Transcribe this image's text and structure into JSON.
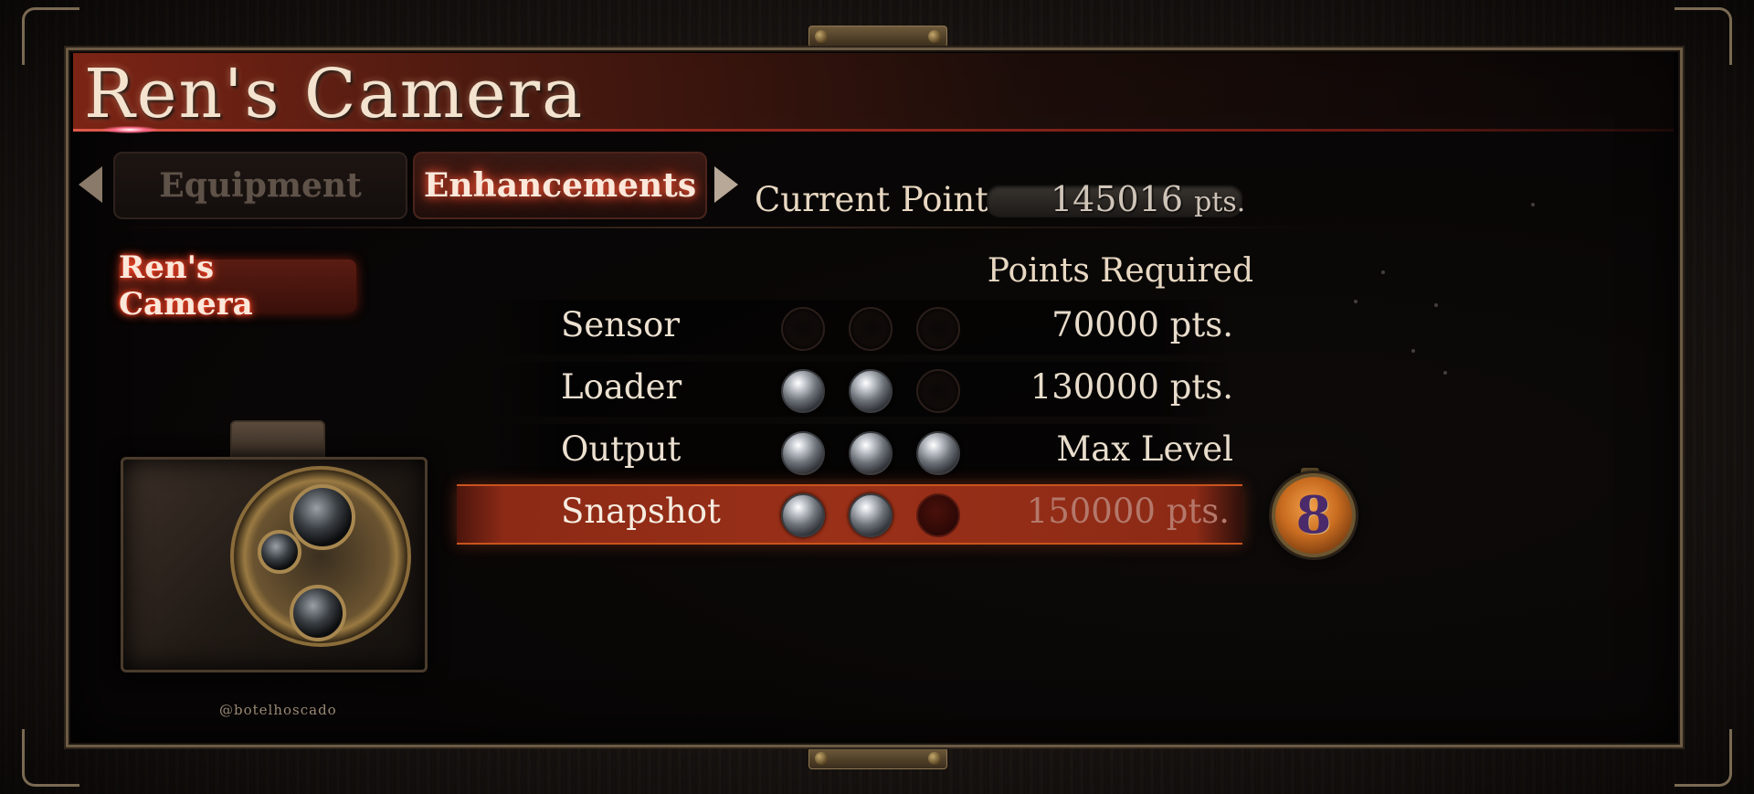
{
  "window": {
    "title": "Ren's Camera"
  },
  "tabs": [
    {
      "label": "Equipment",
      "active": false
    },
    {
      "label": "Enhancements",
      "active": true
    }
  ],
  "points": {
    "label": "Current Points:",
    "value": "145016",
    "unit": "pts."
  },
  "sidebar": {
    "items": [
      {
        "label": "Ren's Camera",
        "selected": true
      }
    ]
  },
  "table": {
    "header": "Points Required",
    "rows": [
      {
        "name": "Sensor",
        "level": 0,
        "max_level": 3,
        "cost": "70000 pts.",
        "selected": false
      },
      {
        "name": "Loader",
        "level": 2,
        "max_level": 3,
        "cost": "130000 pts.",
        "selected": false
      },
      {
        "name": "Output",
        "level": 3,
        "max_level": 3,
        "cost": "Max Level",
        "selected": false
      },
      {
        "name": "Snapshot",
        "level": 2,
        "max_level": 3,
        "cost": "150000 pts.",
        "selected": true
      }
    ]
  },
  "badge": {
    "value": "8"
  },
  "watermark": "@botelhoscado",
  "colors": {
    "accent_red": "#9a3018",
    "glow": "#ff5030",
    "text": "#ece0d0"
  },
  "icons": [
    "left-arrow-icon",
    "right-arrow-icon",
    "camera-illustration",
    "level-badge-icon"
  ]
}
